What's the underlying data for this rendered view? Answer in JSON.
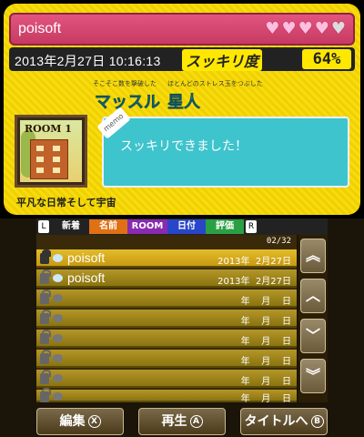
{
  "top": {
    "player_name": "poisoft",
    "hearts": [
      true,
      true,
      true,
      true,
      false
    ],
    "datetime": "2013年2月27日 10:16:13",
    "refresh_label": "スッキリ度",
    "refresh_value": "64%",
    "title_prefix_furigana": "そこそこ数を撃破した",
    "title_prefix": "マッスル",
    "title_suffix_furigana": "ほとんどのストレス玉をつぶした",
    "title_suffix": "星人",
    "room_label": "ROOM 1",
    "memo_tag": "memo",
    "memo_text": "スッキリできました！",
    "subtitle": "平凡な日常そして宇宙"
  },
  "tabs": {
    "left_key": "L",
    "right_key": "R",
    "new": "新着",
    "name": "名前",
    "room": "ROOM",
    "date": "日付",
    "rating": "評価"
  },
  "list": {
    "count": "02/32",
    "rows": [
      {
        "name": "poisoft",
        "date": "2013年  2月27日"
      },
      {
        "name": "poisoft",
        "date": "2013年  2月27日"
      },
      {
        "name": "",
        "date": "年    月    日"
      },
      {
        "name": "",
        "date": "年    月    日"
      },
      {
        "name": "",
        "date": "年    月    日"
      },
      {
        "name": "",
        "date": "年    月    日"
      },
      {
        "name": "",
        "date": "年    月    日"
      },
      {
        "name": "",
        "date": "年    月    日"
      }
    ]
  },
  "scroll": {
    "top": "︽",
    "up": "︿",
    "down": "﹀",
    "bottom": "︾"
  },
  "actions": {
    "edit": "編集",
    "edit_key": "X",
    "play": "再生",
    "play_key": "A",
    "title": "タイトルへ",
    "title_key": "B"
  }
}
